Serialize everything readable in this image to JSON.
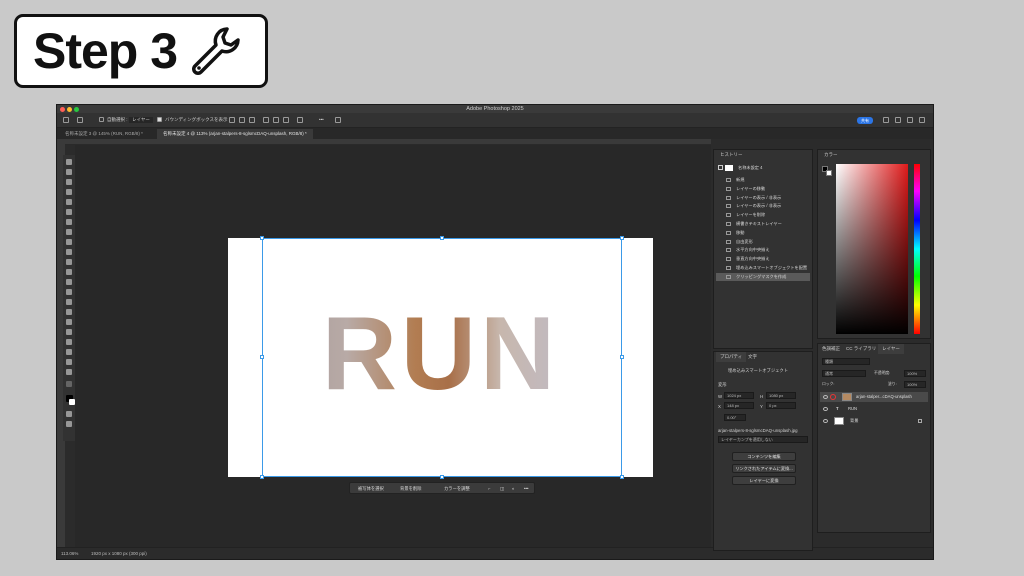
{
  "step_badge": {
    "label": "Step 3",
    "icon": "wrench-icon"
  },
  "window": {
    "title": "Adobe Photoshop 2025"
  },
  "options_bar": {
    "auto_select_label": "自動選択 :",
    "auto_select_value": "レイヤー",
    "bounding_box_label": "バウンディングボックスを表示",
    "share_label": "共有",
    "more_label": "•••"
  },
  "tabs": [
    {
      "label": "名称未設定 3 @ 145% (RUN, RGB/8) *"
    },
    {
      "label": "名称未設定 4 @ 113% (arjan-stalpers-8-sglsmcDAQ-unsplash, RGB/8) *"
    }
  ],
  "document": {
    "text": "RUN"
  },
  "context_bar": {
    "select_subject": "被写体を選択",
    "remove_bg": "背景を削除",
    "adjust_color": "カラーを調整",
    "more_label": "•••"
  },
  "status": {
    "zoom": "113.06%",
    "doc_info": "1920 px x 1080 px (300 ppi)"
  },
  "history": {
    "tab_label": "ヒストリー",
    "snapshot_label": "名称未設定 4",
    "items": [
      "新規",
      "レイヤーの移動",
      "レイヤーの表示 / 非表示",
      "レイヤーの表示 / 非表示",
      "レイヤーを削除",
      "横書きテキストレイヤー",
      "移動",
      "自由変形",
      "水平方向中央揃え",
      "垂直方向中央揃え",
      "埋め込みスマートオブジェクトを配置",
      "クリッピングマスクを作成"
    ],
    "selected_index": 11
  },
  "properties": {
    "tabs": [
      "プロパティ",
      "文字"
    ],
    "type_label": "埋め込みスマートオブジェクト",
    "transform_label": "変形",
    "w_label": "W",
    "w_value": "1024 px",
    "h_label": "H",
    "h_value": "1080 px",
    "x_label": "X",
    "x_value": "148 px",
    "y_label": "Y",
    "y_value": "0 px",
    "angle_value": "0.00°",
    "filename": "arjan-stalpers-8-sglsmcDAQ-unsplash.jpg",
    "comp_placeholder": "レイヤーカンプを適用しない",
    "buttons": [
      "コンテンツを編集",
      "リンクされたアイテムに変換...",
      "レイヤーに変換"
    ]
  },
  "color_panel": {
    "tab_label": "カラー"
  },
  "layers_panel": {
    "tabs": [
      "色調補正",
      "CC ライブラリ",
      "レイヤー"
    ],
    "search_placeholder": "種類",
    "blend_mode": "通常",
    "opacity_label": "不透明度:",
    "opacity_value": "100%",
    "lock_label": "ロック:",
    "fill_label": "塗り:",
    "fill_value": "100%",
    "layers": [
      {
        "name": "arjan-stalper...cDAQ-unsplash",
        "selected": true
      },
      {
        "name": "RUN",
        "selected": false
      },
      {
        "name": "背景",
        "selected": false
      }
    ]
  },
  "colors": {
    "accent": "#3b9ae8",
    "share": "#2b75e6",
    "panel_bg": "#323232"
  }
}
